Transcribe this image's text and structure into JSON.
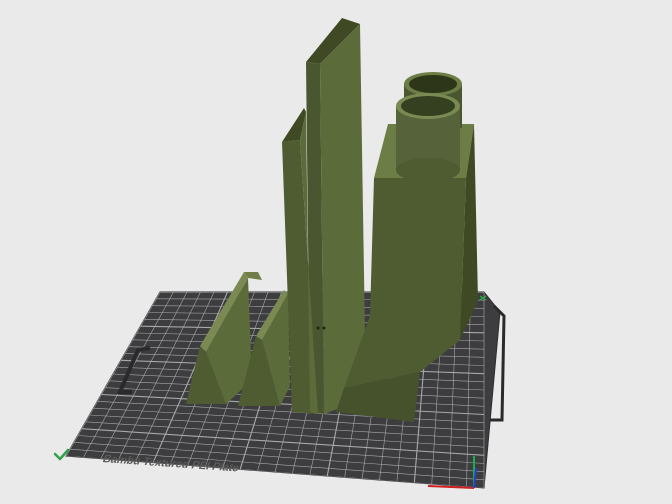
{
  "viewport": {
    "plate_label": "Bambu Textured PEI Plate",
    "plate_color": "#3d3d3f",
    "grid_color": "#a9a9ab",
    "model_color": "#5c6b3a",
    "background_color": "#eaeaea"
  },
  "indicators": {
    "status_icon": "check-icon",
    "status_color": "#2fa24a",
    "axis_colors": {
      "x": "#d22020",
      "y": "#18b04a",
      "z": "#2a3bd6"
    }
  }
}
